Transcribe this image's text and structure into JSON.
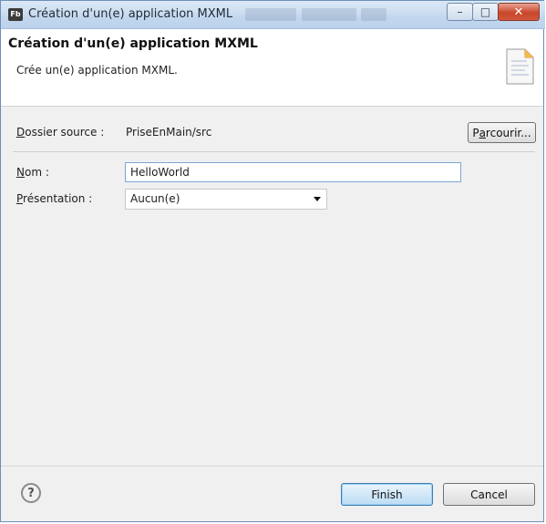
{
  "window": {
    "title": "Création d'un(e) application MXML",
    "app_icon": "Fb",
    "minimize_glyph": "–",
    "maximize_glyph": "□",
    "close_glyph": "✕"
  },
  "header": {
    "title": "Création d'un(e) application MXML",
    "description": "Crée un(e) application MXML."
  },
  "form": {
    "source_folder": {
      "mnemonic": "D",
      "rest": "ossier source :",
      "value": "PriseEnMain/src"
    },
    "browse_button": {
      "pre": "P",
      "mnemonic": "a",
      "rest": "rcourir..."
    },
    "name": {
      "mnemonic": "N",
      "rest": "om :",
      "value": "HelloWorld"
    },
    "layout": {
      "mnemonic": "P",
      "rest": "résentation :",
      "value": "Aucun(e)"
    }
  },
  "footer": {
    "help_glyph": "?",
    "finish_label": "Finish",
    "cancel_label": "Cancel"
  },
  "colors": {
    "accent": "#3c7fb1",
    "close": "#c8462a"
  }
}
